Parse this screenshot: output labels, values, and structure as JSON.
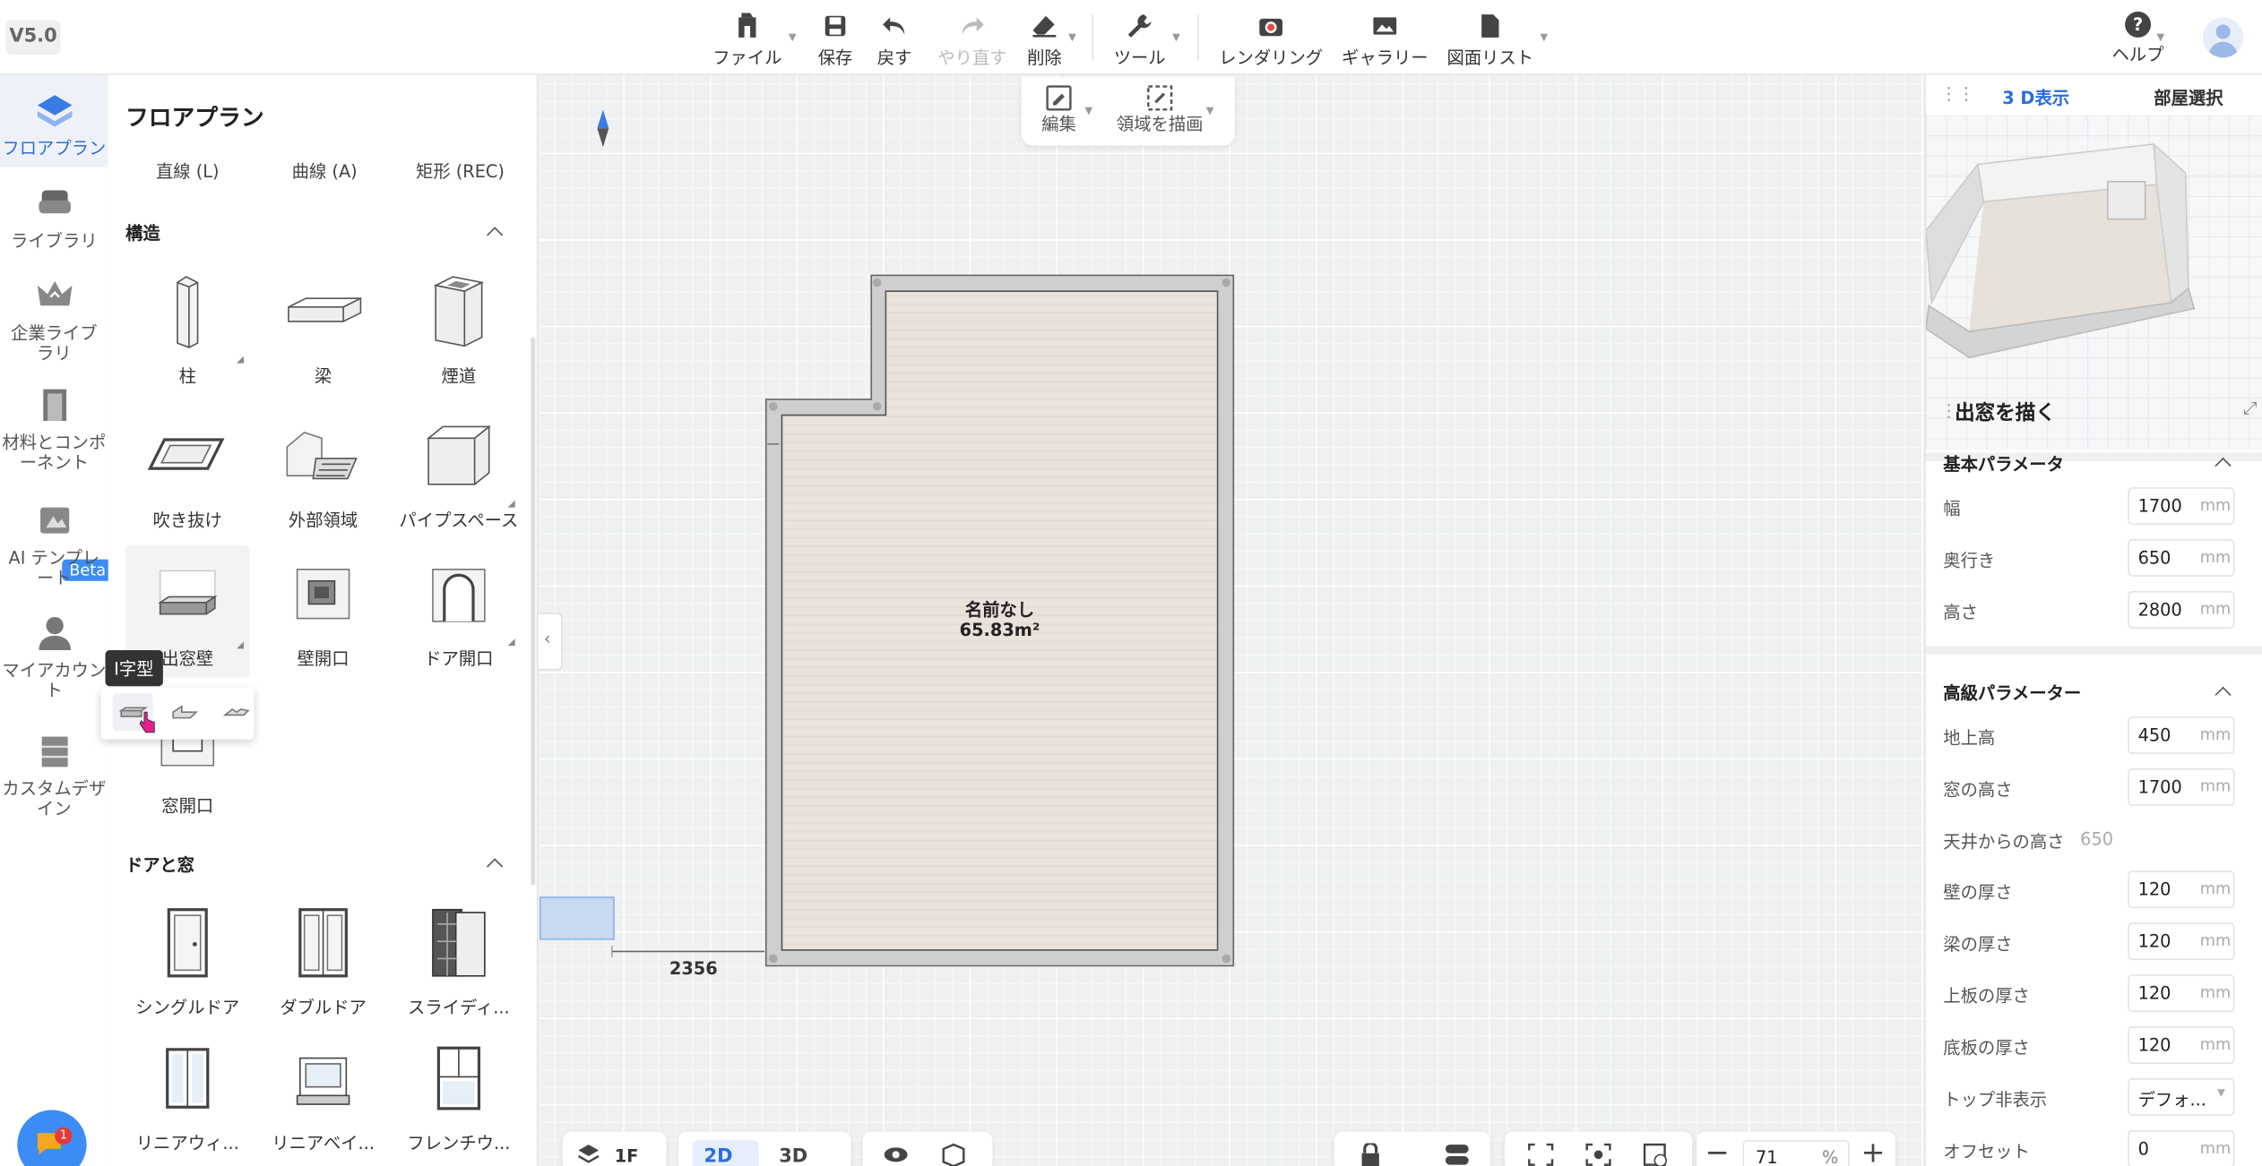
{
  "version": "V5.0",
  "toolbar": {
    "file": "ファイル",
    "save": "保存",
    "undo": "戻す",
    "redo": "やり直す",
    "delete": "削除",
    "tools": "ツール",
    "render": "レンダリング",
    "gallery": "ギャラリー",
    "drawings": "図面リスト",
    "help": "ヘルプ"
  },
  "leftnav": {
    "floorplan": "フロアプラン",
    "library": "ライブラリ",
    "enterprise": "企業ライブラリ",
    "materials": "材料とコンポーネント",
    "beta": "Beta",
    "ai_template": "AI テンプレート",
    "account": "マイアカウント",
    "custom": "カスタムデザイン"
  },
  "panel": {
    "title": "フロアプラン",
    "tabs": [
      "直線 (L)",
      "曲線 (A)",
      "矩形 (REC)"
    ],
    "structure_title": "構造",
    "structure": [
      "柱",
      "梁",
      "煙道",
      "吹き抜け",
      "外部領域",
      "パイプスペース",
      "出窓壁",
      "壁開口",
      "ドア開口",
      "窓開口"
    ],
    "doors_title": "ドアと窓",
    "doors": [
      "シングルドア",
      "ダブルドア",
      "スライディ...",
      "リニアウィ...",
      "リニアベイ...",
      "フレンチウ..."
    ],
    "tooltip": "I字型"
  },
  "canvas": {
    "edit": "編集",
    "draw_area": "領域を描画",
    "room_name": "名前なし",
    "room_area": "65.83m²",
    "dimension": "2356"
  },
  "bottom": {
    "floor": "1F",
    "mode2d": "2D",
    "mode3d": "3D",
    "zoom": "71",
    "zoom_unit": "%"
  },
  "right": {
    "tab_3d": "3 D表示",
    "tab_room": "部屋選択",
    "title": "出窓を描く",
    "basic_title": "基本パラメータ",
    "basic": [
      {
        "label": "幅",
        "value": "1700",
        "unit": "mm"
      },
      {
        "label": "奥行き",
        "value": "650",
        "unit": "mm"
      },
      {
        "label": "高さ",
        "value": "2800",
        "unit": "mm"
      }
    ],
    "adv_title": "高級パラメーター",
    "adv": [
      {
        "label": "地上高",
        "value": "450",
        "unit": "mm"
      },
      {
        "label": "窓の高さ",
        "value": "1700",
        "unit": "mm"
      },
      {
        "label": "天井からの高さ",
        "value": "650",
        "unit": ""
      },
      {
        "label": "壁の厚さ",
        "value": "120",
        "unit": "mm"
      },
      {
        "label": "梁の厚さ",
        "value": "120",
        "unit": "mm"
      },
      {
        "label": "上板の厚さ",
        "value": "120",
        "unit": "mm"
      },
      {
        "label": "底板の厚さ",
        "value": "120",
        "unit": "mm"
      },
      {
        "label": "トップ非表示",
        "value": "デフォ...",
        "unit": ""
      },
      {
        "label": "オフセット",
        "value": "0",
        "unit": "mm"
      }
    ]
  },
  "colors": {
    "accent": "#2b6de0",
    "badge": "#3c8cf5"
  }
}
